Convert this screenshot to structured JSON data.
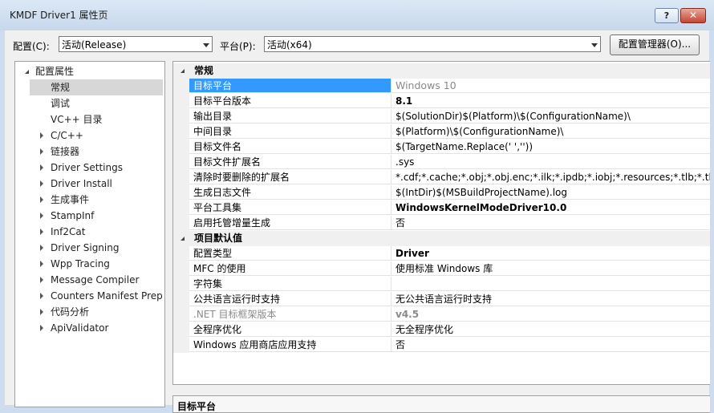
{
  "window": {
    "title": "KMDF Driver1 属性页",
    "help_label": "?",
    "close_label": "✕"
  },
  "toolbar": {
    "config_label": "配置(C):",
    "config_value": "活动(Release)",
    "platform_label": "平台(P):",
    "platform_value": "活动(x64)",
    "config_manager_label": "配置管理器(O)..."
  },
  "tree": {
    "root": "配置属性",
    "items": [
      {
        "label": "常规",
        "expandable": false,
        "selected": true
      },
      {
        "label": "调试",
        "expandable": false
      },
      {
        "label": "VC++ 目录",
        "expandable": false
      },
      {
        "label": "C/C++",
        "expandable": true
      },
      {
        "label": "链接器",
        "expandable": true
      },
      {
        "label": "Driver Settings",
        "expandable": true
      },
      {
        "label": "Driver Install",
        "expandable": true
      },
      {
        "label": "生成事件",
        "expandable": true
      },
      {
        "label": "StampInf",
        "expandable": true
      },
      {
        "label": "Inf2Cat",
        "expandable": true
      },
      {
        "label": "Driver Signing",
        "expandable": true
      },
      {
        "label": "Wpp Tracing",
        "expandable": true
      },
      {
        "label": "Message Compiler",
        "expandable": true
      },
      {
        "label": "Counters Manifest Preprocessor",
        "expandable": true
      },
      {
        "label": "代码分析",
        "expandable": true
      },
      {
        "label": "ApiValidator",
        "expandable": true
      }
    ]
  },
  "grid": {
    "general": {
      "title": "常规",
      "rows": [
        {
          "name": "目标平台",
          "value": "Windows 10"
        },
        {
          "name": "目标平台版本",
          "value": "8.1"
        },
        {
          "name": "输出目录",
          "value": "$(SolutionDir)$(Platform)\\$(ConfigurationName)\\"
        },
        {
          "name": "中间目录",
          "value": "$(Platform)\\$(ConfigurationName)\\"
        },
        {
          "name": "目标文件名",
          "value": "$(TargetName.Replace(' ',''))"
        },
        {
          "name": "目标文件扩展名",
          "value": ".sys"
        },
        {
          "name": "清除时要删除的扩展名",
          "value": "*.cdf;*.cache;*.obj;*.obj.enc;*.ilk;*.ipdb;*.iobj;*.resources;*.tlb;*.tli;*.t"
        },
        {
          "name": "生成日志文件",
          "value": "$(IntDir)$(MSBuildProjectName).log"
        },
        {
          "name": "平台工具集",
          "value": "WindowsKernelModeDriver10.0"
        },
        {
          "name": "启用托管增量生成",
          "value": "否"
        }
      ]
    },
    "defaults": {
      "title": "项目默认值",
      "rows": [
        {
          "name": "配置类型",
          "value": "Driver"
        },
        {
          "name": "MFC 的使用",
          "value": "使用标准 Windows 库"
        },
        {
          "name": "字符集",
          "value": ""
        },
        {
          "name": "公共语言运行时支持",
          "value": "无公共语言运行时支持"
        },
        {
          "name": ".NET 目标框架版本",
          "value": "v4.5"
        },
        {
          "name": "全程序优化",
          "value": "无全程序优化"
        },
        {
          "name": "Windows 应用商店应用支持",
          "value": "否"
        }
      ]
    }
  },
  "description": {
    "title": "目标平台"
  }
}
